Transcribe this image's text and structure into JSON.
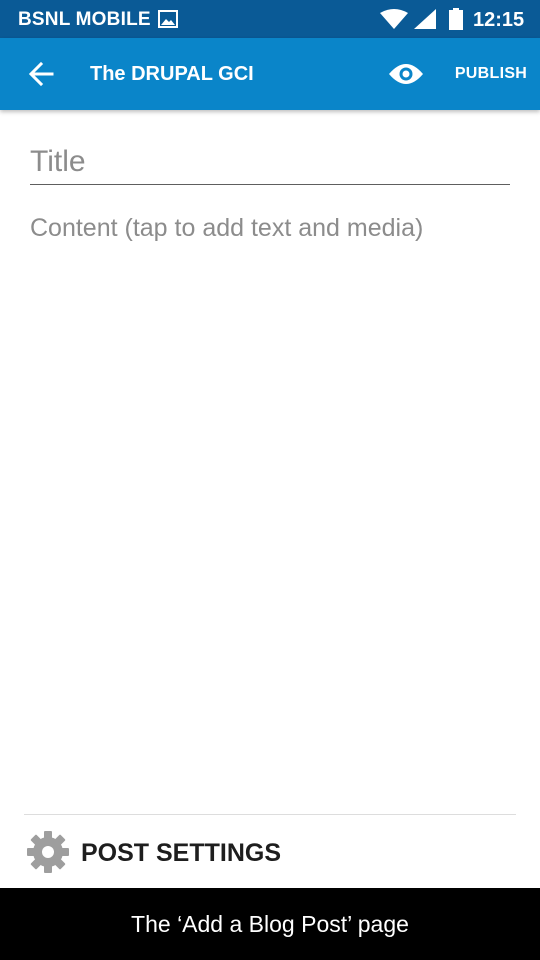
{
  "status_bar": {
    "carrier": "BSNL MOBILE",
    "time": "12:15",
    "icons": [
      "gallery-icon",
      "wifi-icon",
      "signal-icon",
      "battery-icon"
    ],
    "background_color": "#0a5a96"
  },
  "app_bar": {
    "title": "The DRUPAL GCI",
    "back_icon": "arrow-left-icon",
    "preview_icon": "eye-icon",
    "publish_label": "PUBLISH",
    "background_color": "#0a85c9"
  },
  "editor": {
    "title_placeholder": "Title",
    "content_placeholder": "Content (tap to add text and media)"
  },
  "post_settings": {
    "icon": "gear-icon",
    "label": "POST SETTINGS"
  },
  "caption": {
    "text": "The ‘Add a Blog Post’ page"
  }
}
